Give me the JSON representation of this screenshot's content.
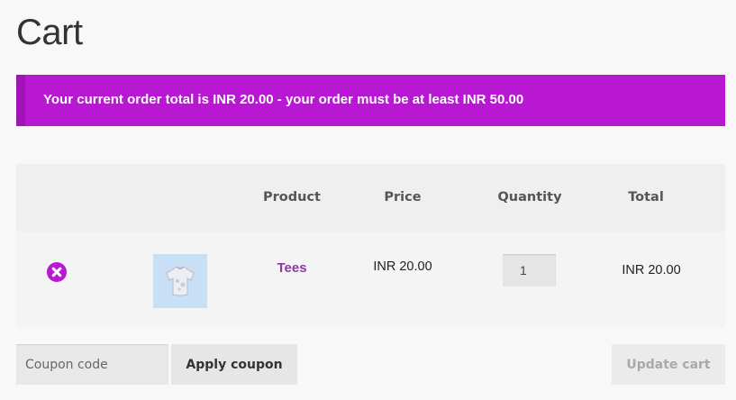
{
  "page": {
    "title": "Cart"
  },
  "notice": {
    "message": "Your current order total is INR 20.00 - your order must be at least INR 50.00",
    "background_color": "#b818d1",
    "border_color": "#a013b6"
  },
  "cart": {
    "columns": {
      "product": "Product",
      "price": "Price",
      "quantity": "Quantity",
      "total": "Total"
    },
    "items": [
      {
        "remove_icon": "close-circle-icon",
        "thumbnail": "tshirt-thumbnail",
        "name": "Tees",
        "price": "INR 20.00",
        "quantity": "1",
        "subtotal": "INR 20.00"
      }
    ]
  },
  "actions": {
    "coupon_placeholder": "Coupon code",
    "apply_coupon_label": "Apply coupon",
    "update_cart_label": "Update cart"
  },
  "colors": {
    "accent": "#b818d1",
    "link": "#8d3aa0"
  }
}
